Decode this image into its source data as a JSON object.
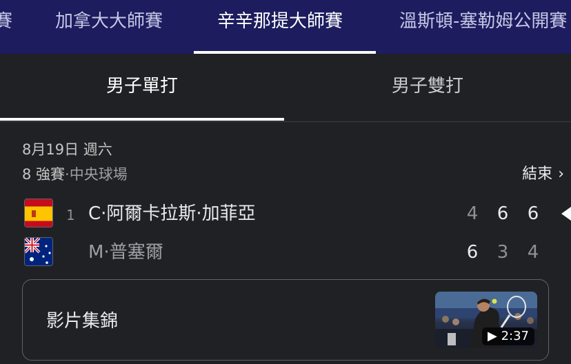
{
  "tournaments": {
    "tabs": [
      {
        "label": "賽"
      },
      {
        "label": "加拿大大師賽"
      },
      {
        "label": "辛辛那提大師賽"
      },
      {
        "label": "溫斯頓-塞勒姆公開賽"
      }
    ],
    "active_index": 2
  },
  "event_tabs": [
    {
      "label": "男子單打"
    },
    {
      "label": "男子雙打"
    }
  ],
  "match": {
    "date": "8月19日 週六",
    "round": "8 強賽",
    "separator": "·",
    "venue": "中央球場",
    "status": "結束",
    "players": [
      {
        "seed": "1",
        "name": "C·阿爾卡拉斯·加菲亞",
        "flag": "spain-flag-icon",
        "scores": [
          "4",
          "6",
          "6"
        ],
        "winner": true
      },
      {
        "seed": "",
        "name": "M·普塞爾",
        "flag": "australia-flag-icon",
        "scores": [
          "6",
          "3",
          "4"
        ],
        "winner": false
      }
    ]
  },
  "highlights": {
    "label": "影片集錦",
    "duration": "2:37",
    "icon": "play-icon"
  },
  "colors": {
    "nav_bg": "#1c1c5e",
    "page_bg": "#202124",
    "text": "#e8eaed",
    "muted": "#9aa0a6"
  }
}
